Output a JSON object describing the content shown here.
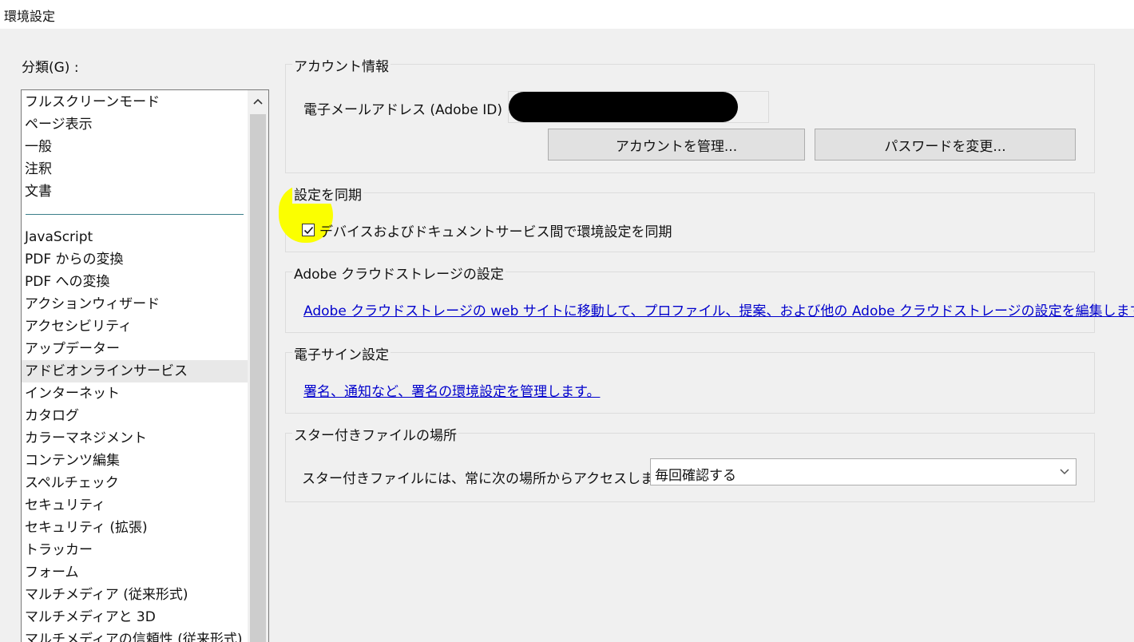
{
  "window": {
    "title": "環境設定"
  },
  "categories": {
    "label": "分類(G) :",
    "items_top": [
      "フルスクリーンモード",
      "ページ表示",
      "一般",
      "注釈",
      "文書"
    ],
    "items_bottom": [
      "JavaScript",
      "PDF からの変換",
      "PDF への変換",
      "アクションウィザード",
      "アクセシビリティ",
      "アップデーター",
      "アドビオンラインサービス",
      "インターネット",
      "カタログ",
      "カラーマネジメント",
      "コンテンツ編集",
      "スペルチェック",
      "セキュリティ",
      "セキュリティ (拡張)",
      "トラッカー",
      "フォーム",
      "マルチメディア (従来形式)",
      "マルチメディアと 3D",
      "マルチメディアの信頼性 (従来形式)"
    ],
    "selected": "アドビオンラインサービス",
    "scroll_up_icon": "chevron-up-icon"
  },
  "account": {
    "title": "アカウント情報",
    "email_label": "電子メールアドレス (Adobe ID) :",
    "email_value": "",
    "manage_button": "アカウントを管理...",
    "password_button": "パスワードを変更..."
  },
  "sync": {
    "title": "設定を同期",
    "checkbox_label": "デバイスおよびドキュメントサービス間で環境設定を同期",
    "checked": true,
    "highlight_color": "#fbff00"
  },
  "cloud": {
    "title": "Adobe クラウドストレージの設定",
    "link": "Adobe クラウドストレージの web サイトに移動して、プロファイル、提案、および他の Adobe クラウドストレージの設定を編集します。"
  },
  "esign": {
    "title": "電子サイン設定",
    "link": "署名、通知など、署名の環境設定を管理します。"
  },
  "starred": {
    "title": "スター付きファイルの場所",
    "label": "スター付きファイルには、常に次の場所からアクセスします...",
    "selected": "毎回確認する"
  }
}
